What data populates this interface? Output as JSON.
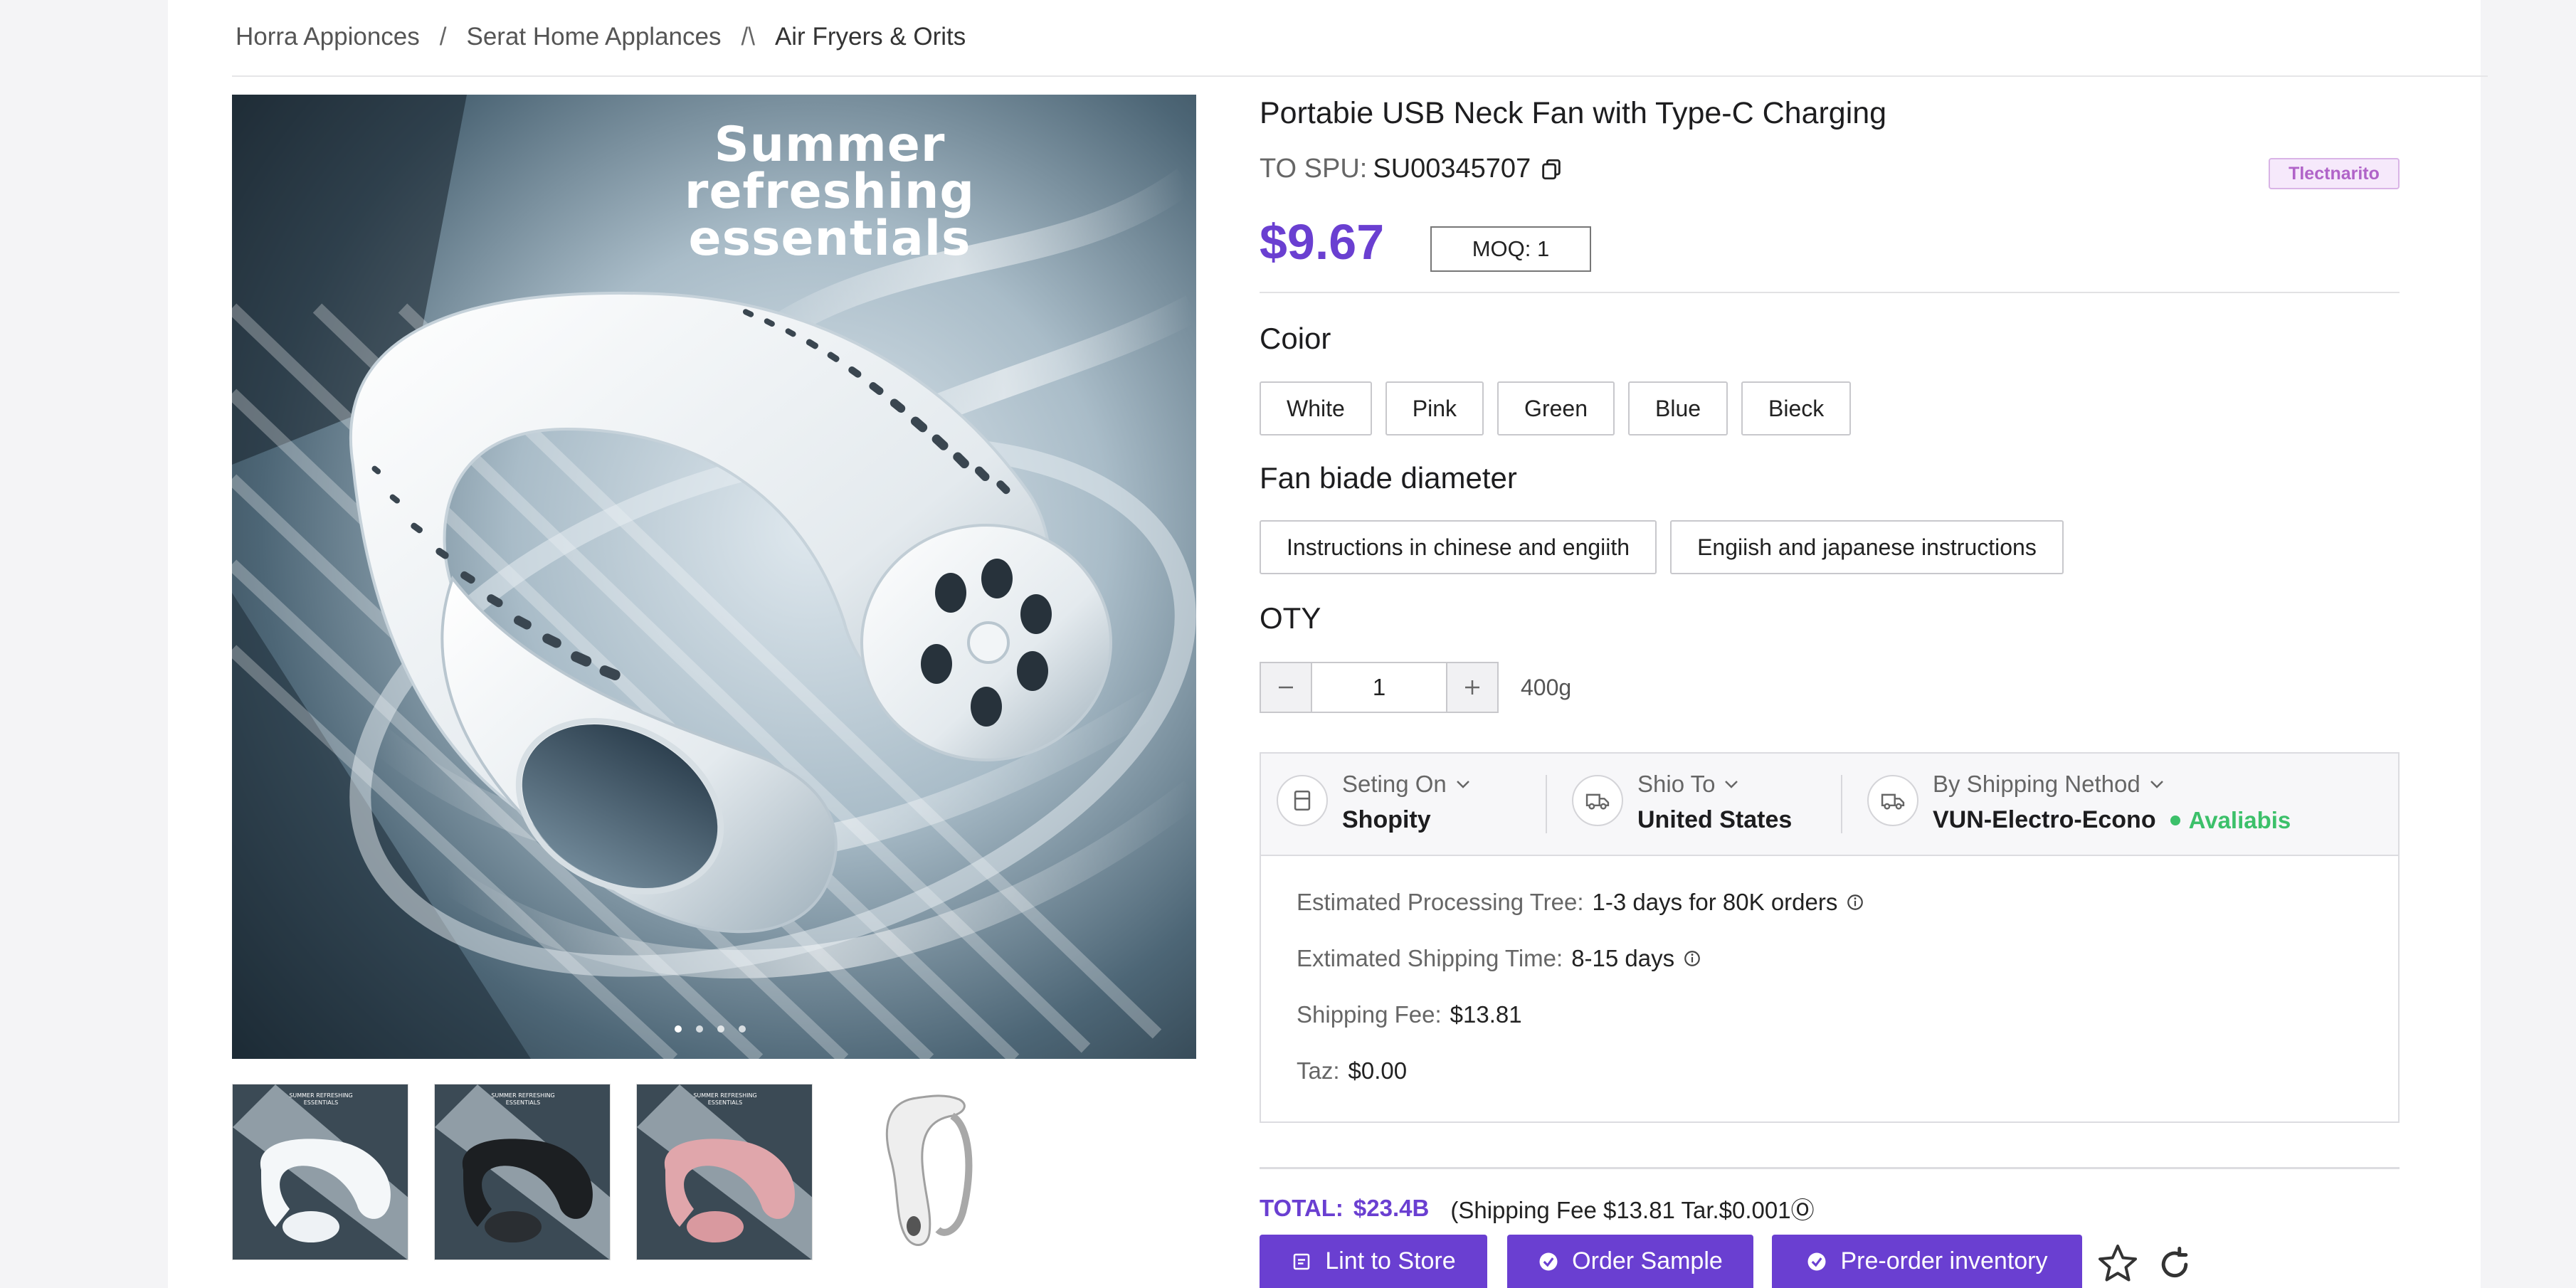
{
  "breadcrumb": {
    "items": [
      "Horra Appionces",
      "Serat Home Applances",
      "Air Fryers & Orits"
    ],
    "separators": [
      "/",
      "/\\"
    ]
  },
  "hero": {
    "headline_line1": "Summer refreshing",
    "headline_line2": "essentials"
  },
  "thumbnails": [
    {
      "caption_line1": "SUMMER REFRESHING",
      "caption_line2": "ESSENTIALS",
      "color": "white"
    },
    {
      "caption_line1": "SUMMER REFRESHING",
      "caption_line2": "ESSENTIALS",
      "color": "black"
    },
    {
      "caption_line1": "SUMMER REFRESHING",
      "caption_line2": "ESSENTIALS",
      "color": "pink"
    },
    {
      "color": "white-side-view"
    }
  ],
  "product": {
    "title": "Portabie USB Neck Fan with Type-C Charging",
    "spu_label": "TO SPU:",
    "spu_value": "SU00345707",
    "tag": "Tlectnarito",
    "price": "$9.67",
    "moq": "MOQ: 1"
  },
  "options": {
    "color_label": "Coior",
    "colors": [
      "White",
      "Pink",
      "Green",
      "Blue",
      "Bieck"
    ],
    "fan_label": "Fan biade diameter",
    "fan_options": [
      "Instructions in chinese and engiith",
      "Engiish and japanese instructions"
    ],
    "qty_label": "OTY",
    "qty_value": "1",
    "weight": "400g"
  },
  "shipping": {
    "selling_on_label": "Seting On",
    "selling_on_value": "Shopity",
    "ship_to_label": "Shio To",
    "ship_to_value": "United States",
    "method_label": "By Shipping Nethod",
    "method_value": "VUN-Electro-Econo",
    "availability": "Avaliabis",
    "processing_label": "Estimated Processing Tree:",
    "processing_value": "1-3 days for 80K orders",
    "shipping_time_label": "Extimated Shipping Time:",
    "shipping_time_value": "8-15 days",
    "fee_label": "Shipping Fee:",
    "fee_value": "$13.81",
    "tax_label": "Taz:",
    "tax_value": "$0.00"
  },
  "total": {
    "label": "TOTAL:",
    "value": "$23.4B",
    "detail": "(Shipping Fee $13.81  Tar.$0.001Ⓞ"
  },
  "actions": {
    "list": "Lint to Store",
    "sample": "Order Sample",
    "preorder": "Pre-order inventory"
  },
  "colors": {
    "accent": "#6a3fd1",
    "available": "#3cc06a",
    "tag_text": "#b063c8"
  }
}
